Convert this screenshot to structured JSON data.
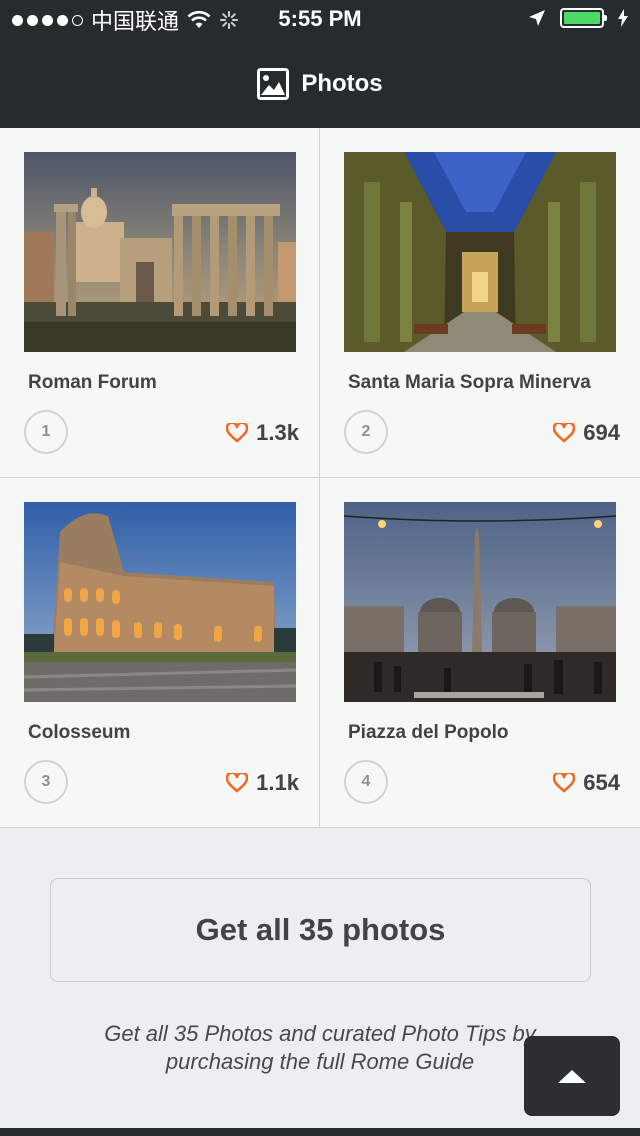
{
  "status_bar": {
    "carrier": "中国联通",
    "time": "5:55 PM",
    "battery_color": "#4cd964"
  },
  "navbar": {
    "title": "Photos",
    "icon": "photo-icon"
  },
  "photos": [
    {
      "title": "Roman Forum",
      "rank": "1",
      "likes": "1.3k"
    },
    {
      "title": "Santa Maria Sopra Minerva",
      "rank": "2",
      "likes": "694"
    },
    {
      "title": "Colosseum",
      "rank": "3",
      "likes": "1.1k"
    },
    {
      "title": "Piazza del Popolo",
      "rank": "4",
      "likes": "654"
    }
  ],
  "cta": {
    "label": "Get all 35 photos"
  },
  "footnote": {
    "text": "Get all 35 Photos and curated Photo Tips by purchasing the full Rome Guide"
  },
  "colors": {
    "navbar_bg": "#262b2e",
    "heart": "#f26722",
    "text_dark": "#3f4446"
  }
}
